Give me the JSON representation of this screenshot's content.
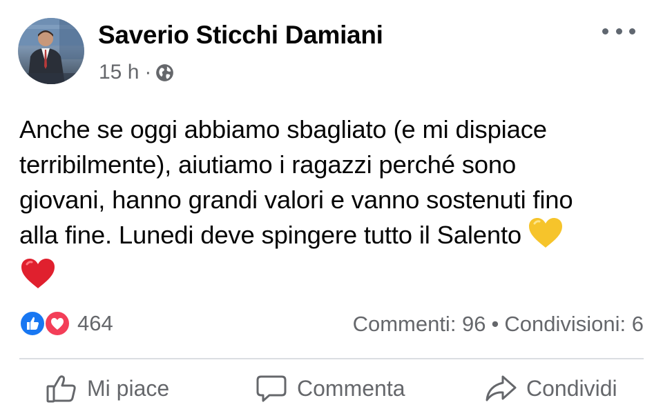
{
  "post": {
    "author": "Saverio Sticchi Damiani",
    "time": "15 h",
    "separator": "·",
    "visibility_icon": "globe-icon",
    "more_icon": "more-options-icon",
    "text_lines": [
      "Anche se oggi abbiamo sbagliato  (e mi dispiace",
      "terribilmente), aiutiamo i ragazzi perché sono",
      "giovani, hanno grandi valori e vanno sostenuti fino",
      "alla fine. Lunedi deve spingere tutto il Salento"
    ],
    "emojis": [
      "yellow-heart-emoji",
      "red-heart-emoji"
    ]
  },
  "reactions": {
    "icons": [
      "like-reaction-icon",
      "love-reaction-icon"
    ],
    "count": "464",
    "comments": "Commenti: 96",
    "bullet": "•",
    "shares": "Condivisioni: 6"
  },
  "actions": {
    "like": "Mi piace",
    "comment": "Commenta",
    "share": "Condividi"
  },
  "colors": {
    "like_blue": "#1877f2",
    "love_red": "#f33e58",
    "secondary_text": "#65676b",
    "primary_text": "#050505"
  }
}
